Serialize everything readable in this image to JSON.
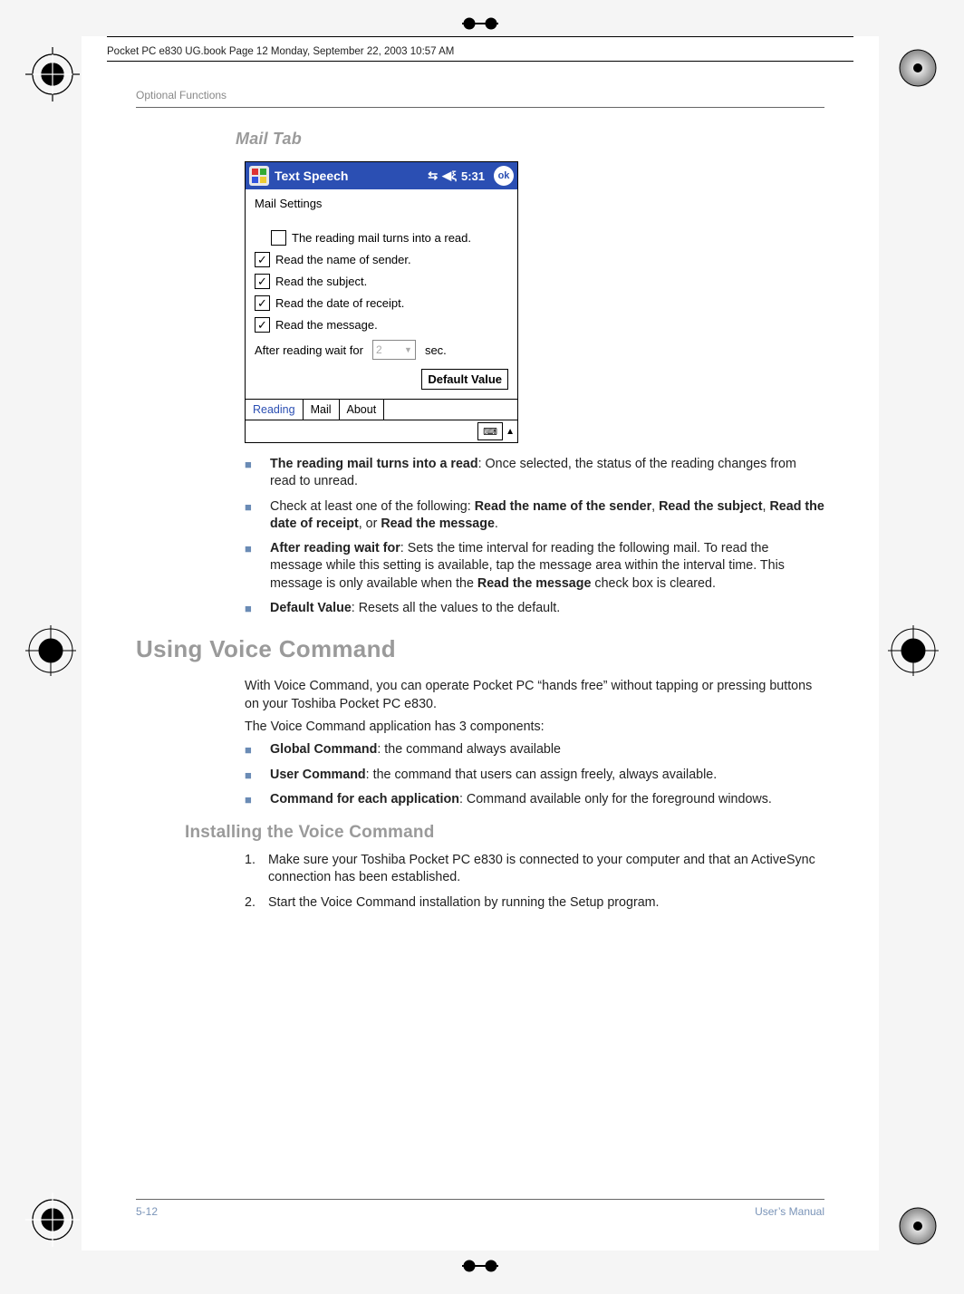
{
  "print_header": "Pocket PC e830 UG.book  Page 12  Monday, September 22, 2003  10:57 AM",
  "running_head": "Optional Functions",
  "mail_tab_heading": "Mail Tab",
  "screenshot": {
    "app_title": "Text Speech",
    "time": "5:31",
    "ok": "ok",
    "subhead": "Mail Settings",
    "options": [
      {
        "checked": false,
        "label": "The reading mail turns into a read.",
        "indent": true
      },
      {
        "checked": true,
        "label": "Read the name of sender.",
        "indent": false
      },
      {
        "checked": true,
        "label": "Read the subject.",
        "indent": false
      },
      {
        "checked": true,
        "label": "Read the date of receipt.",
        "indent": false
      },
      {
        "checked": true,
        "label": "Read the message.",
        "indent": false
      }
    ],
    "wait_label": "After reading wait for",
    "wait_value": "2",
    "wait_unit": "sec.",
    "default_btn": "Default Value",
    "tabs": [
      "Reading",
      "Mail",
      "About"
    ],
    "active_tab": 0
  },
  "mail_bullets": [
    {
      "b": "The reading mail turns into a read",
      "rest": ": Once selected, the status of the reading changes from read to unread."
    },
    {
      "pre": "Check at least one of the following: ",
      "b1": "Read the name of the sender",
      "mid1": ", ",
      "b2": "Read the subject",
      "mid2": ", ",
      "b3": "Read the date of receipt",
      "mid3": ", or ",
      "b4": "Read the message",
      "end": "."
    },
    {
      "b": "After reading wait for",
      "rest": ": Sets the time interval for reading the following mail. To read the message while this setting is available, tap the message area within the interval time. This message is only available when the ",
      "b2": "Read the message",
      "rest2": " check box is cleared."
    },
    {
      "b": "Default Value",
      "rest": ": Resets all the values to the default."
    }
  ],
  "voice_heading": "Using Voice Command",
  "voice_p1": "With Voice Command, you can operate Pocket PC “hands free” without tapping or pressing buttons on your Toshiba Pocket PC e830.",
  "voice_p2": "The Voice Command application has 3 components:",
  "voice_bullets": [
    {
      "b": "Global Command",
      "rest": ": the command always available"
    },
    {
      "b": "User Command",
      "rest": ": the command that users can assign freely, always available."
    },
    {
      "b": "Command for each application",
      "rest": ": Command available only for the foreground windows."
    }
  ],
  "install_heading": "Installing the Voice Command",
  "install_steps": [
    "Make sure your Toshiba Pocket PC e830 is connected to your computer and that an ActiveSync connection has been established.",
    "Start the Voice Command installation by running the Setup program."
  ],
  "footer_left": "5-12",
  "footer_right": "User’s Manual"
}
